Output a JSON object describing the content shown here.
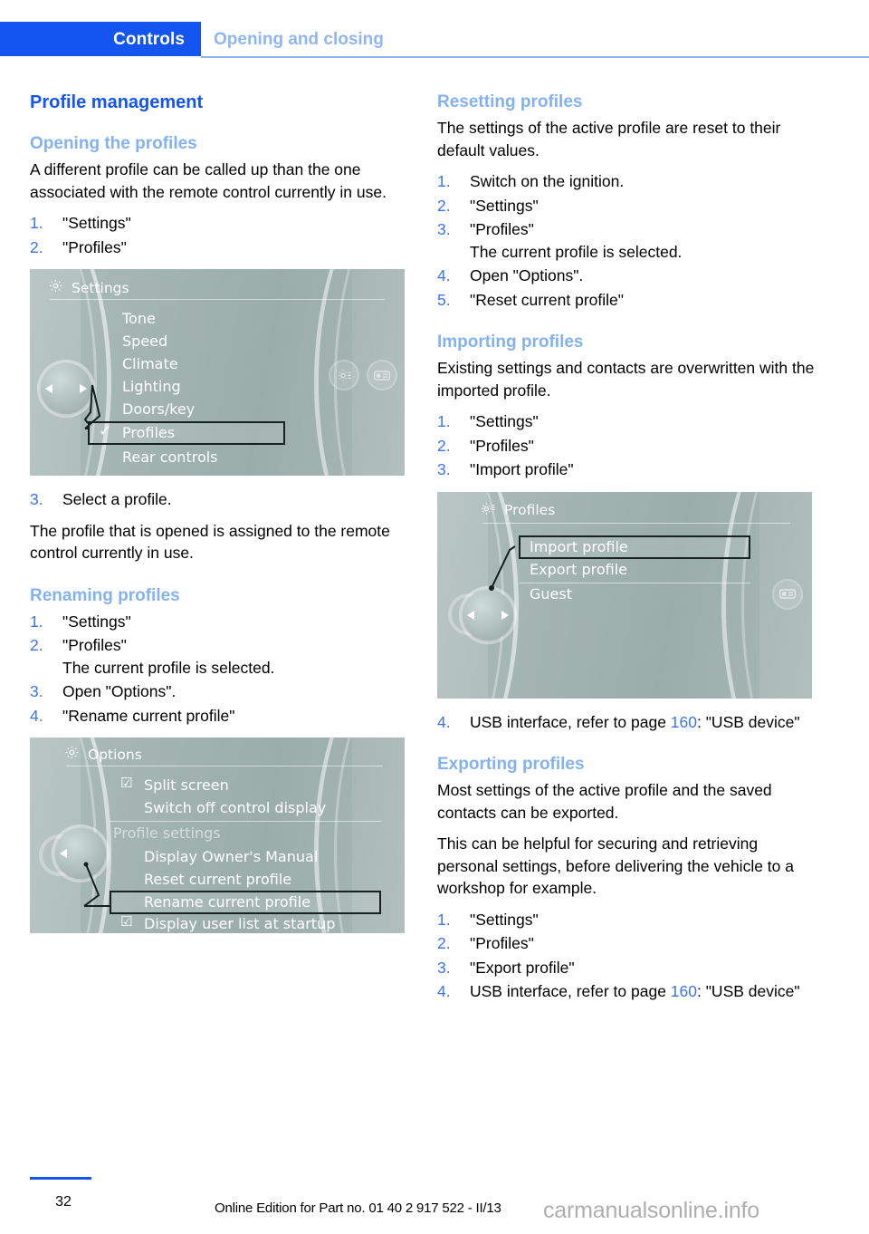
{
  "header": {
    "chapter": "Controls",
    "section": "Opening and closing"
  },
  "left_column": {
    "title": "Profile management",
    "opening": {
      "heading": "Opening the profiles",
      "intro": "A different profile can be called up than the one associated with the remote control currently in use.",
      "steps": [
        "\"Settings\"",
        "\"Profiles\""
      ],
      "step3": "Select a profile.",
      "after": "The profile that is opened is assigned to the remote control currently in use."
    },
    "renaming": {
      "heading": "Renaming profiles",
      "steps": [
        "\"Settings\"",
        "\"Profiles\"",
        "Open \"Options\".",
        "\"Rename current profile\""
      ],
      "note_after_step2": "The current profile is selected."
    }
  },
  "right_column": {
    "resetting": {
      "heading": "Resetting profiles",
      "intro": "The settings of the active profile are reset to their default values.",
      "steps": [
        "Switch on the ignition.",
        "\"Settings\"",
        "\"Profiles\"",
        "Open \"Options\".",
        "\"Reset current profile\""
      ],
      "note_after_step3": "The current profile is selected."
    },
    "importing": {
      "heading": "Importing profiles",
      "intro": "Existing settings and contacts are overwritten with the imported profile.",
      "steps": [
        "\"Settings\"",
        "\"Profiles\"",
        "\"Import profile\""
      ],
      "step4_pre": "USB interface, refer to page ",
      "step4_page": "160",
      "step4_post": ": \"USB device\""
    },
    "exporting": {
      "heading": "Exporting profiles",
      "intro": "Most settings of the active profile and the saved contacts can be exported.",
      "intro2": "This can be helpful for securing and retrieving personal settings, before delivering the vehicle to a workshop for example.",
      "steps": [
        "\"Settings\"",
        "\"Profiles\"",
        "\"Export profile\""
      ],
      "step4_pre": "USB interface, refer to page ",
      "step4_page": "160",
      "step4_post": ": \"USB device\""
    }
  },
  "figures": {
    "settings_screen": {
      "title": "Settings",
      "items": [
        "Tone",
        "Speed",
        "Climate",
        "Lighting",
        "Doors/key",
        "Profiles",
        "Rear controls"
      ],
      "selected": "Profiles",
      "checked": "Profiles",
      "check_glyph": "✓"
    },
    "options_screen": {
      "title": "Options",
      "items": [
        "Split screen",
        "Switch off control display",
        "Profile settings",
        "Display Owner's Manual",
        "Reset current profile",
        "Rename current profile",
        "Display user list at startup"
      ],
      "selected": "Rename current profile",
      "group_label": "Profile settings",
      "checkbox_glyph": "☑"
    },
    "profiles_screen": {
      "title": "Profiles",
      "items": [
        "Import profile",
        "Export profile",
        "Guest"
      ],
      "selected": "Import profile"
    }
  },
  "footer": {
    "page_number": "32",
    "edition": "Online Edition for Part no. 01 40 2 917 522 - II/13",
    "watermark": "carmanualsonline.info"
  },
  "colors": {
    "brand_blue": "#1455f0",
    "light_blue": "#84b2f0",
    "step_blue": "#3a74ee",
    "screen_bg": "#a6b6b4"
  }
}
